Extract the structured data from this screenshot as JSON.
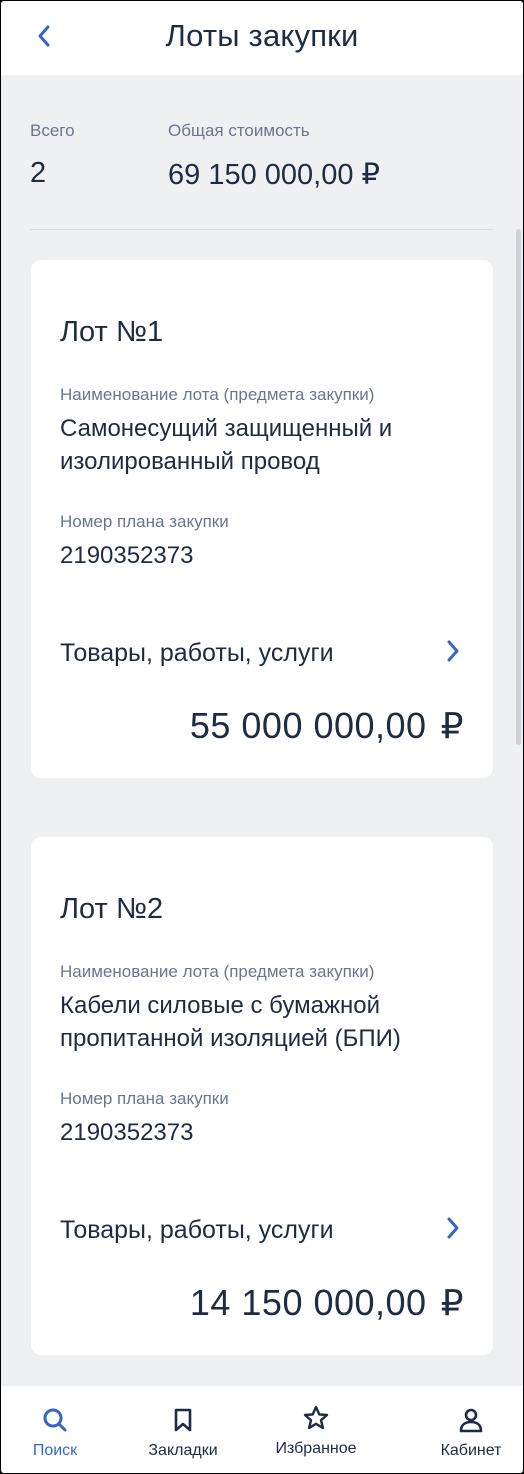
{
  "header": {
    "title": "Лоты закупки"
  },
  "summary": {
    "total_label": "Всего",
    "total_value": "2",
    "cost_label": "Общая стоимость",
    "cost_value": "69 150 000,00 ₽"
  },
  "lots": [
    {
      "title": "Лот №1",
      "name_label": "Наименование лота (предмета закупки)",
      "name_value": "Самонесущий защищенный и изолированный провод",
      "plan_label": "Номер плана закупки",
      "plan_value": "2190352373",
      "goods_label": "Товары, работы, услуги",
      "price": "55 000 000,00",
      "currency": "₽"
    },
    {
      "title": "Лот №2",
      "name_label": "Наименование лота (предмета закупки)",
      "name_value": "Кабели силовые с бумажной пропитанной изоляцией (БПИ)",
      "plan_label": "Номер плана закупки",
      "plan_value": "2190352373",
      "goods_label": "Товары, работы, услуги",
      "price": "14 150 000,00",
      "currency": "₽"
    }
  ],
  "bottom_nav": [
    {
      "label": "Поиск",
      "icon": "search-icon",
      "active": true
    },
    {
      "label": "Закладки",
      "icon": "bookmark-icon",
      "active": false
    },
    {
      "label": "Избранное",
      "icon": "star-icon",
      "active": false
    },
    {
      "label": "Кабинет",
      "icon": "user-icon",
      "active": false
    }
  ],
  "colors": {
    "accent": "#3566c4",
    "text": "#1f2a44",
    "muted": "#6b7590",
    "background": "#eef0f2",
    "card": "#ffffff"
  }
}
